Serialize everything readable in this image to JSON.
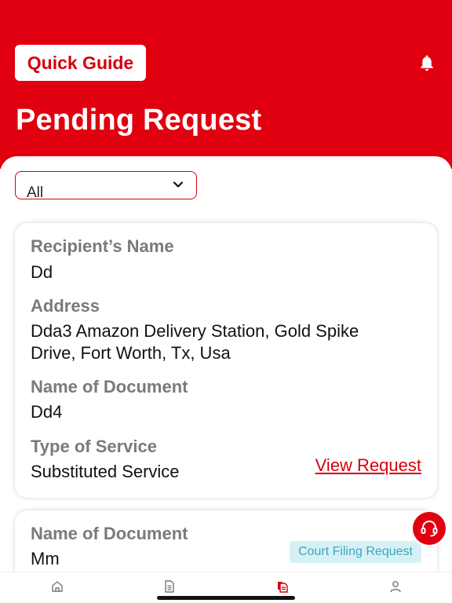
{
  "header": {
    "quick_guide_label": "Quick Guide",
    "title": "Pending Request",
    "bell_icon": "bell-icon",
    "bg_color": "#e0000f"
  },
  "filter": {
    "selected": "All",
    "chevron_icon": "chevron-down-icon"
  },
  "cards": [
    {
      "recipient_label": "Recipient’s Name",
      "recipient_value": "Dd",
      "address_label": "Address",
      "address_value": "Dda3 Amazon Delivery Station, Gold Spike Drive, Fort Worth, Tx, Usa",
      "document_label": "Name of Document",
      "document_value": "Dd4",
      "service_label": "Type of Service",
      "service_value": "Substituted Service",
      "view_label": "View Request"
    },
    {
      "document_label": "Name of Document",
      "document_value": "Mm",
      "badge": "Court Filing Request"
    }
  ],
  "support_icon": "headset-icon",
  "tabbar": {
    "items": [
      "home-icon",
      "document-icon",
      "requests-icon",
      "profile-icon"
    ],
    "active_color": "#d4000e"
  }
}
